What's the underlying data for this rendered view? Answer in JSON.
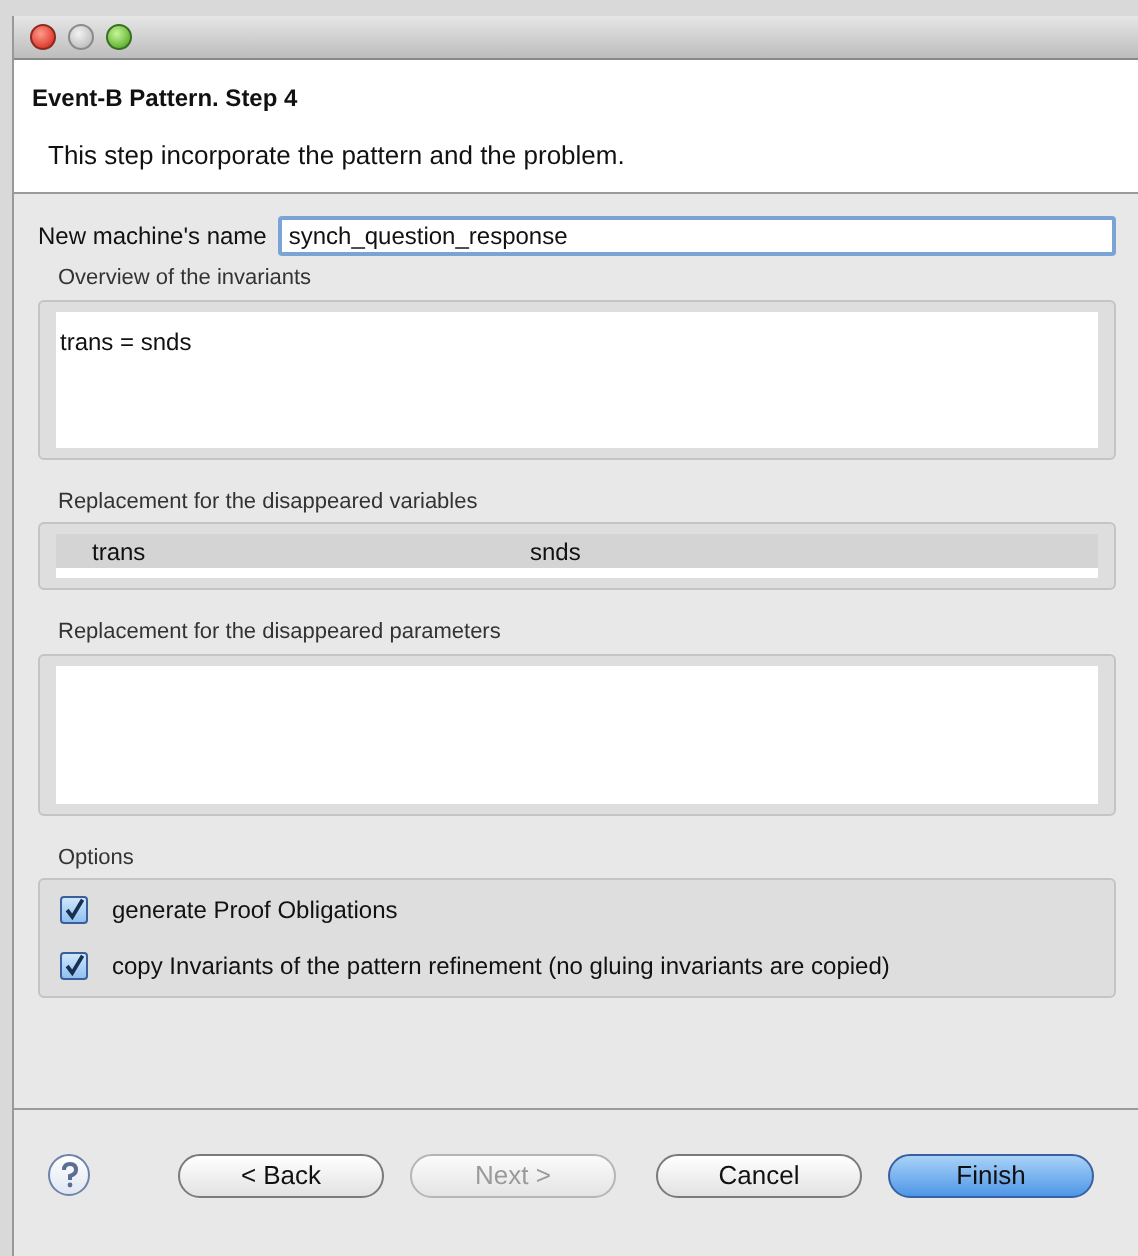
{
  "header": {
    "title": "Event-B Pattern. Step 4",
    "description": "This step incorporate the pattern and the problem."
  },
  "name_field": {
    "label": "New machine's name",
    "value": "synch_question_response"
  },
  "invariants": {
    "label": "Overview of the invariants",
    "text": "trans = snds"
  },
  "variables": {
    "label": "Replacement for the disappeared variables",
    "rows": [
      {
        "column_1": "trans",
        "column_2": "snds",
        "selected": true
      }
    ]
  },
  "parameters": {
    "label": "Replacement for the disappeared parameters"
  },
  "options": {
    "label": "Options",
    "items": [
      {
        "label": "generate Proof Obligations",
        "checked": true
      },
      {
        "label": "copy Invariants of the pattern refinement (no gluing invariants are copied)",
        "checked": true
      }
    ]
  },
  "buttons": [
    {
      "label": "< Back",
      "disabled": false,
      "default": false
    },
    {
      "label": "Next >",
      "disabled": true,
      "default": false
    },
    {
      "label": "Cancel",
      "disabled": false,
      "default": false
    },
    {
      "label": "Finish",
      "disabled": false,
      "default": true
    }
  ]
}
